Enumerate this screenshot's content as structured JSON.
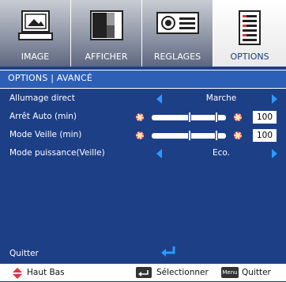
{
  "tabs": [
    {
      "label": "IMAGE",
      "icon": "picture-frame-icon",
      "active": false
    },
    {
      "label": "AFFICHER",
      "icon": "screen-contrast-icon",
      "active": false
    },
    {
      "label": "REGLAGES",
      "icon": "projector-icon",
      "active": false
    },
    {
      "label": "OPTIONS",
      "icon": "options-list-icon",
      "active": true
    }
  ],
  "title": "OPTIONS | AVANCÉ",
  "rows": [
    {
      "label": "Allumage direct",
      "type": "select",
      "value": "Marche"
    },
    {
      "label": "Arrêt Auto (min)",
      "type": "slider",
      "value": "100",
      "level": 100
    },
    {
      "label": "Mode Veille (min)",
      "type": "slider",
      "value": "100",
      "level": 100
    },
    {
      "label": "Mode puissance(Veille)",
      "type": "select",
      "value": "Eco."
    }
  ],
  "quit_label": "Quitter",
  "footer": {
    "nav_label": "Haut Bas",
    "select_label": "Sélectionner",
    "menu_key": "Menu",
    "quit_label": "Quitter"
  },
  "colors": {
    "background": "#1d3f86",
    "title_bar": "#2d5fb6",
    "arrow": "#2a9bff",
    "accent_red": "#e8323c"
  }
}
